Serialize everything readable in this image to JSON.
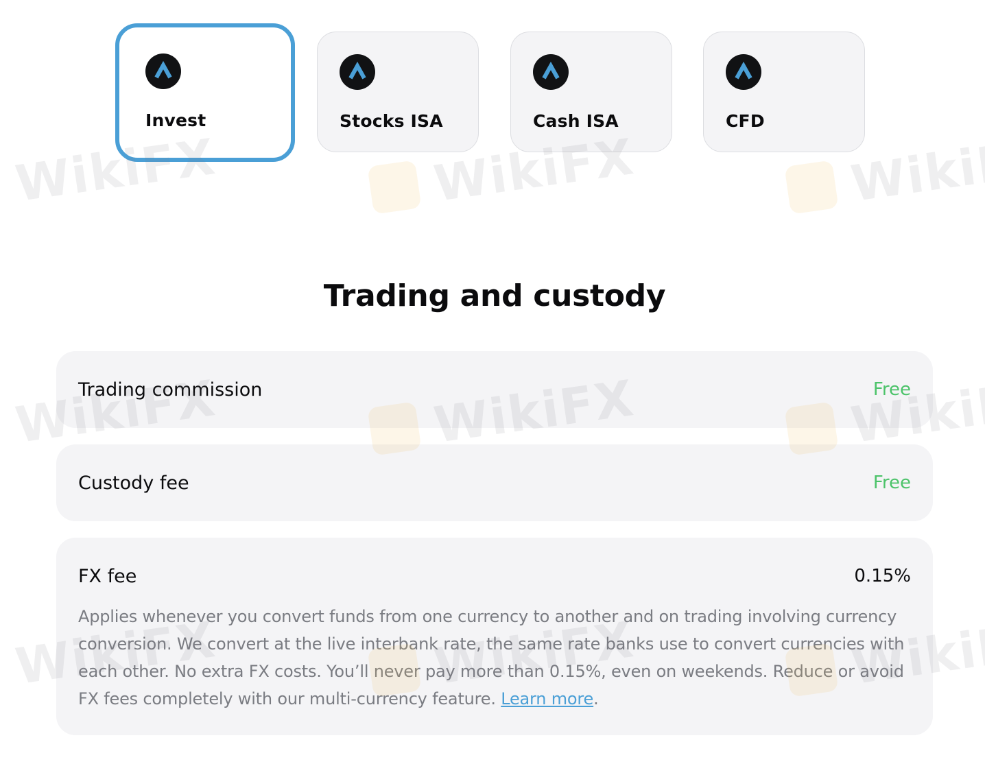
{
  "colors": {
    "accent": "#4a9fd6",
    "free_green": "#4cc36a",
    "card_bg": "#f4f4f6",
    "logo_bg": "#111214"
  },
  "tabs": [
    {
      "label": "Invest",
      "icon": "brand-caret-logo-icon",
      "selected": true
    },
    {
      "label": "Stocks ISA",
      "icon": "brand-caret-logo-icon",
      "selected": false
    },
    {
      "label": "Cash ISA",
      "icon": "brand-caret-logo-icon",
      "selected": false
    },
    {
      "label": "CFD",
      "icon": "brand-caret-logo-icon",
      "selected": false
    }
  ],
  "section": {
    "title": "Trading and custody"
  },
  "fees": {
    "trading_commission": {
      "name": "Trading commission",
      "value": "Free"
    },
    "custody_fee": {
      "name": "Custody fee",
      "value": "Free"
    },
    "fx_fee": {
      "name": "FX fee",
      "value": "0.15%",
      "description": "Applies whenever you convert funds from one currency to another and on trading involving currency conversion. We convert at the live interbank rate, the same rate banks use to convert currencies with each other. No extra FX costs. You’ll never pay more than 0.15%, even on weekends. Reduce or avoid FX fees completely with our multi-currency feature.",
      "link_label": "Learn more",
      "link_suffix": "."
    }
  },
  "watermark": {
    "text": "WikiFX"
  }
}
